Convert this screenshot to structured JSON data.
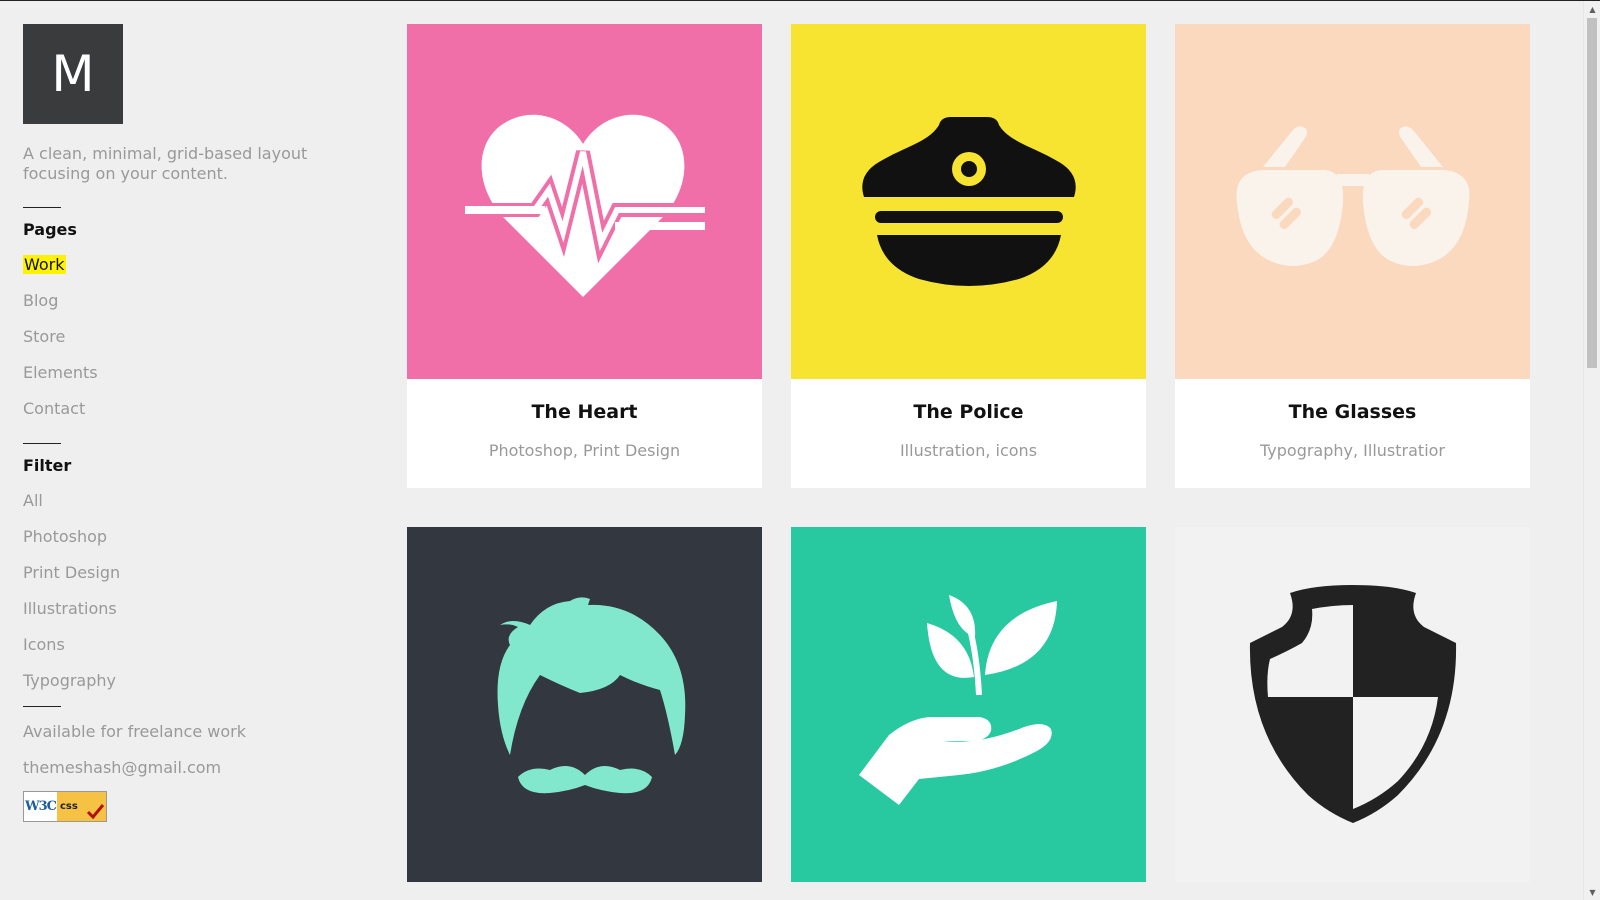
{
  "logo": {
    "letter": "M"
  },
  "tagline": "A clean, minimal, grid-based layout focusing on your content.",
  "pages": {
    "title": "Pages",
    "items": [
      "Work",
      "Blog",
      "Store",
      "Elements",
      "Contact"
    ],
    "active": "Work"
  },
  "filter": {
    "title": "Filter",
    "items": [
      "All",
      "Photoshop",
      "Print Design",
      "Illustrations",
      "Icons",
      "Typography"
    ]
  },
  "footer": {
    "availability": "Available for freelance work",
    "email": "themeshash@gmail.com",
    "badge": {
      "left": "W3C",
      "right": "css"
    }
  },
  "projects": [
    {
      "title": "The Heart",
      "categories": [
        "Photoshop",
        "Print Design"
      ],
      "color": "#f06fa8",
      "icon": "heart-pulse-icon"
    },
    {
      "title": "The Police",
      "categories": [
        "Illustration",
        "icons"
      ],
      "color": "#f6e431",
      "icon": "police-cap-icon"
    },
    {
      "title": "The Glasses",
      "categories": [
        "Typography",
        "Illustratior"
      ],
      "color": "#fad9bf",
      "icon": "sunglasses-icon"
    },
    {
      "title": "",
      "categories": [],
      "color": "#333840",
      "icon": "hair-mustache-icon"
    },
    {
      "title": "",
      "categories": [],
      "color": "#28c8a0",
      "icon": "hand-plant-icon"
    },
    {
      "title": "",
      "categories": [],
      "color": "#f2f2f2",
      "icon": "shield-icon"
    }
  ],
  "colors": {
    "accent_highlight": "#fff200",
    "logo_bg": "#3a3b3c",
    "text_muted": "#999999",
    "text_dark": "#111111"
  }
}
